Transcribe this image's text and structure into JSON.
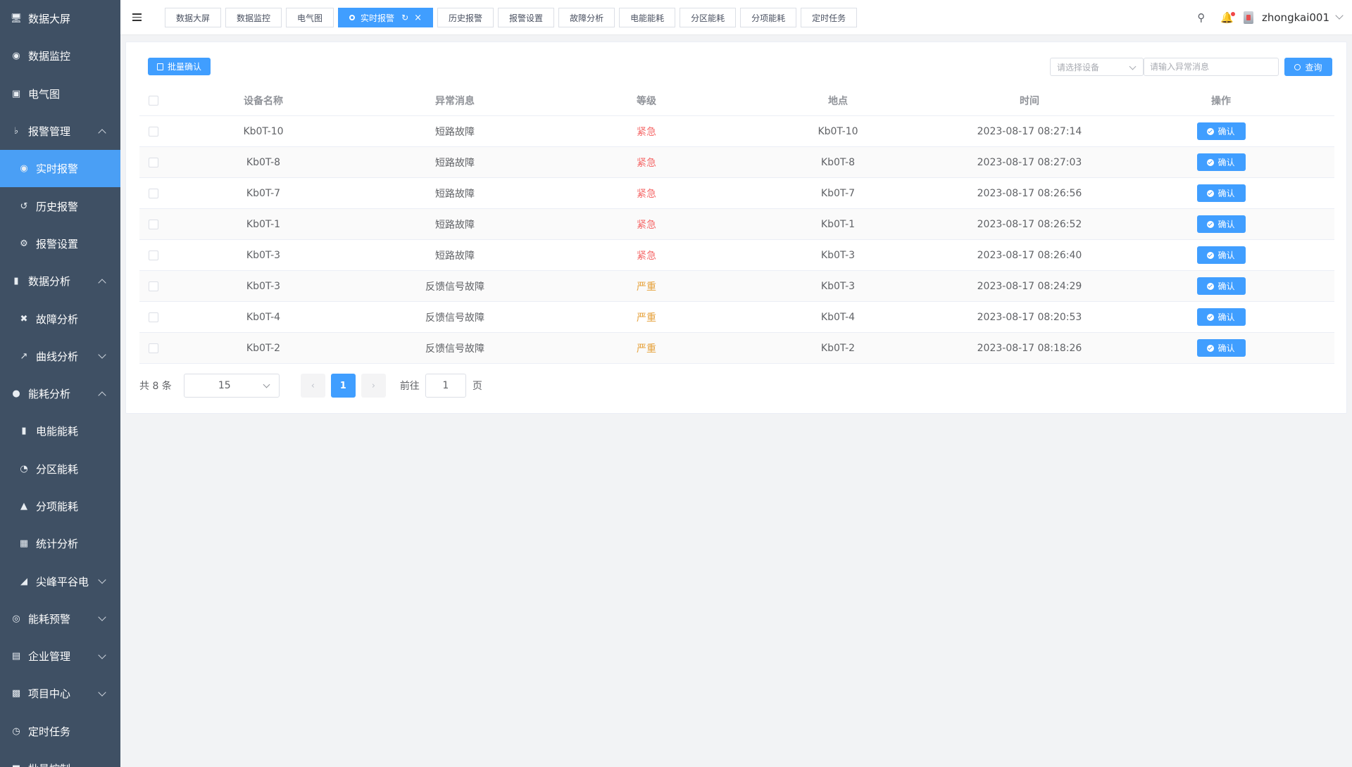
{
  "sidebar": {
    "items": [
      {
        "label": "数据大屏",
        "icon": "monitor-icon",
        "level": 1
      },
      {
        "label": "数据监控",
        "icon": "binoculars-icon",
        "level": 1
      },
      {
        "label": "电气图",
        "icon": "image-icon",
        "level": 1
      },
      {
        "label": "报警管理",
        "icon": "bell-icon",
        "level": 1,
        "arrow": "up"
      },
      {
        "label": "实时报警",
        "icon": "alarm-icon",
        "level": 2,
        "active": true
      },
      {
        "label": "历史报警",
        "icon": "history-icon",
        "level": 2
      },
      {
        "label": "报警设置",
        "icon": "gear-icon",
        "level": 2
      },
      {
        "label": "数据分析",
        "icon": "bar-chart-icon",
        "level": 1,
        "arrow": "up"
      },
      {
        "label": "故障分析",
        "icon": "close-circle-icon",
        "level": 2
      },
      {
        "label": "曲线分析",
        "icon": "line-chart-icon",
        "level": 2,
        "arrow": "down"
      },
      {
        "label": "能耗分析",
        "icon": "bulb-icon",
        "level": 1,
        "arrow": "up"
      },
      {
        "label": "电能能耗",
        "icon": "signal-icon",
        "level": 2
      },
      {
        "label": "分区能耗",
        "icon": "pie-icon",
        "level": 2
      },
      {
        "label": "分项能耗",
        "icon": "cubes-icon",
        "level": 2
      },
      {
        "label": "统计分析",
        "icon": "chip-icon",
        "level": 2
      },
      {
        "label": "尖峰平谷电",
        "icon": "area-chart-icon",
        "level": 2,
        "arrow": "down"
      },
      {
        "label": "能耗预警",
        "icon": "gauge-icon",
        "level": 1,
        "arrow": "down"
      },
      {
        "label": "企业管理",
        "icon": "building-icon",
        "level": 1,
        "arrow": "down"
      },
      {
        "label": "项目中心",
        "icon": "briefcase-icon",
        "level": 1,
        "arrow": "down"
      },
      {
        "label": "定时任务",
        "icon": "clock-icon",
        "level": 1
      },
      {
        "label": "批量控制",
        "icon": "control-icon",
        "level": 1
      }
    ]
  },
  "topbar": {
    "tabs": [
      {
        "label": "数据大屏"
      },
      {
        "label": "数据监控"
      },
      {
        "label": "电气图"
      },
      {
        "label": "实时报警",
        "active": true
      },
      {
        "label": "历史报警"
      },
      {
        "label": "报警设置"
      },
      {
        "label": "故障分析"
      },
      {
        "label": "电能能耗"
      },
      {
        "label": "分区能耗"
      },
      {
        "label": "分项能耗"
      },
      {
        "label": "定时任务"
      }
    ],
    "username": "zhongkai001"
  },
  "toolbar": {
    "batch_confirm_label": "批量确认",
    "device_select_placeholder": "请选择设备",
    "message_input_placeholder": "请输入异常消息",
    "query_label": "查询"
  },
  "table": {
    "headers": {
      "name": "设备名称",
      "message": "异常消息",
      "level": "等级",
      "location": "地点",
      "time": "时间",
      "action": "操作"
    },
    "confirm_label": "确认",
    "rows": [
      {
        "name": "Kb0T-10",
        "message": "短路故障",
        "level": "紧急",
        "level_color": "#f56c6c",
        "location": "Kb0T-10",
        "time": "2023-08-17 08:27:14"
      },
      {
        "name": "Kb0T-8",
        "message": "短路故障",
        "level": "紧急",
        "level_color": "#f56c6c",
        "location": "Kb0T-8",
        "time": "2023-08-17 08:27:03"
      },
      {
        "name": "Kb0T-7",
        "message": "短路故障",
        "level": "紧急",
        "level_color": "#f56c6c",
        "location": "Kb0T-7",
        "time": "2023-08-17 08:26:56"
      },
      {
        "name": "Kb0T-1",
        "message": "短路故障",
        "level": "紧急",
        "level_color": "#f56c6c",
        "location": "Kb0T-1",
        "time": "2023-08-17 08:26:52"
      },
      {
        "name": "Kb0T-3",
        "message": "短路故障",
        "level": "紧急",
        "level_color": "#f56c6c",
        "location": "Kb0T-3",
        "time": "2023-08-17 08:26:40"
      },
      {
        "name": "Kb0T-3",
        "message": "反馈信号故障",
        "level": "严重",
        "level_color": "#e6a23c",
        "location": "Kb0T-3",
        "time": "2023-08-17 08:24:29"
      },
      {
        "name": "Kb0T-4",
        "message": "反馈信号故障",
        "level": "严重",
        "level_color": "#e6a23c",
        "location": "Kb0T-4",
        "time": "2023-08-17 08:20:53"
      },
      {
        "name": "Kb0T-2",
        "message": "反馈信号故障",
        "level": "严重",
        "level_color": "#e6a23c",
        "location": "Kb0T-2",
        "time": "2023-08-17 08:18:26"
      }
    ]
  },
  "pagination": {
    "total_text": "共 8 条",
    "page_size": "15",
    "current_page": "1",
    "goto_label": "前往",
    "goto_value": "1",
    "page_suffix": "页"
  },
  "colors": {
    "accent": "#409eff",
    "sidebar_bg": "#3f5064",
    "urgent": "#f56c6c",
    "serious": "#e6a23c"
  }
}
